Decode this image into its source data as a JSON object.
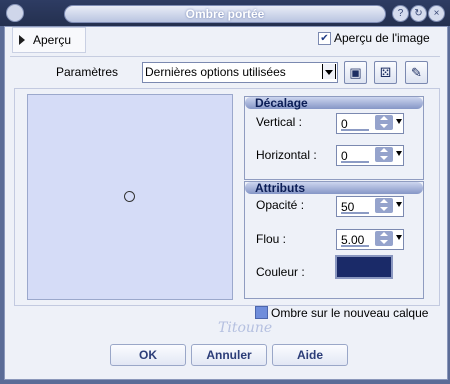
{
  "window": {
    "title": "Ombre portée",
    "title_buttons": [
      "help-icon",
      "settings-icon",
      "close-icon"
    ]
  },
  "preview_toggle": {
    "label": "Aperçu"
  },
  "apercu_image": {
    "label": "Aperçu de l'image",
    "checked": true
  },
  "params": {
    "label": "Paramètres",
    "selected": "Dernières options utilisées",
    "icons": [
      "save-icon",
      "random-icon",
      "reset-icon"
    ]
  },
  "decalage": {
    "title": "Décalage",
    "vertical_label": "Vertical :",
    "vertical_value": "0",
    "horizontal_label": "Horizontal :",
    "horizontal_value": "0"
  },
  "attributs": {
    "title": "Attributs",
    "opacite_label": "Opacité :",
    "opacite_value": "50",
    "flou_label": "Flou :",
    "flou_value": "5.00",
    "couleur_label": "Couleur :",
    "couleur_hex": "#1a2a68"
  },
  "new_layer": {
    "label": "Ombre sur le nouveau calque",
    "checked": true
  },
  "signature": "Titoune",
  "buttons": {
    "ok": "OK",
    "cancel": "Annuler",
    "help": "Aide"
  }
}
